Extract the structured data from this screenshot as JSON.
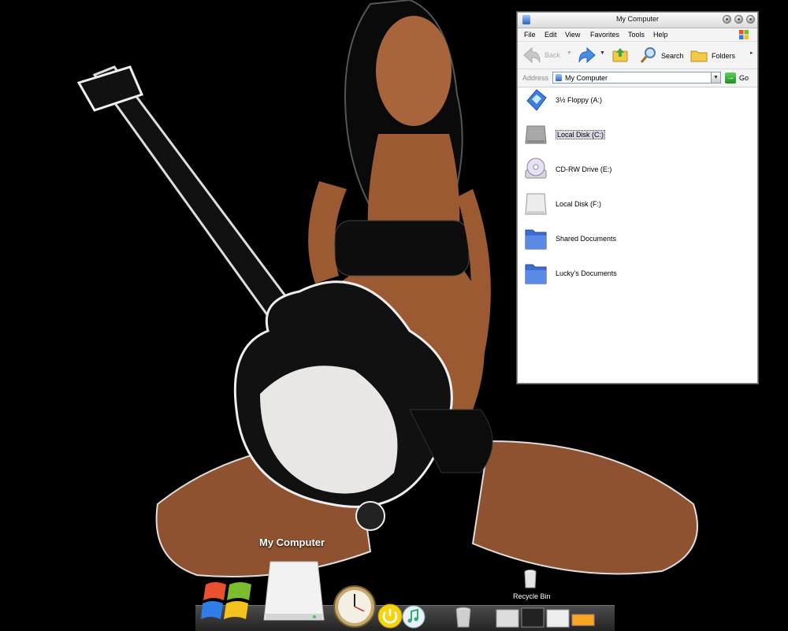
{
  "window": {
    "title": "My Computer",
    "menu": [
      "File",
      "Edit",
      "View",
      "Favorites",
      "Tools",
      "Help"
    ],
    "toolbar": {
      "back_label": "Back",
      "search_label": "Search",
      "folders_label": "Folders"
    },
    "address": {
      "label": "Address",
      "value": "My Computer",
      "go_label": "Go"
    },
    "items": [
      {
        "label": "3½ Floppy (A:)",
        "icon": "floppy-drive-icon",
        "selected": false
      },
      {
        "label": "Local Disk (C:)",
        "icon": "hard-disk-icon",
        "selected": true
      },
      {
        "label": "CD-RW Drive (E:)",
        "icon": "cd-drive-icon",
        "selected": false
      },
      {
        "label": "Local Disk (F:)",
        "icon": "hard-disk-icon",
        "selected": false
      },
      {
        "label": "Shared Documents",
        "icon": "folder-icon",
        "selected": false
      },
      {
        "label": "Lucky's Documents",
        "icon": "folder-icon",
        "selected": false
      }
    ]
  },
  "dock": {
    "active_label": "My Computer",
    "recycle_label": "Recycle Bin",
    "icons": [
      "windows-start-icon",
      "hard-drive-icon",
      "clock-icon",
      "power-icon",
      "itunes-icon",
      "recycle-bin-icon",
      "thumbnail-icon",
      "drive-icon"
    ]
  },
  "colors": {
    "desktop": "#000000",
    "window_bg": "#ffffff",
    "selection": "#d9d9e6",
    "folder_blue": "#3b6fd4"
  }
}
